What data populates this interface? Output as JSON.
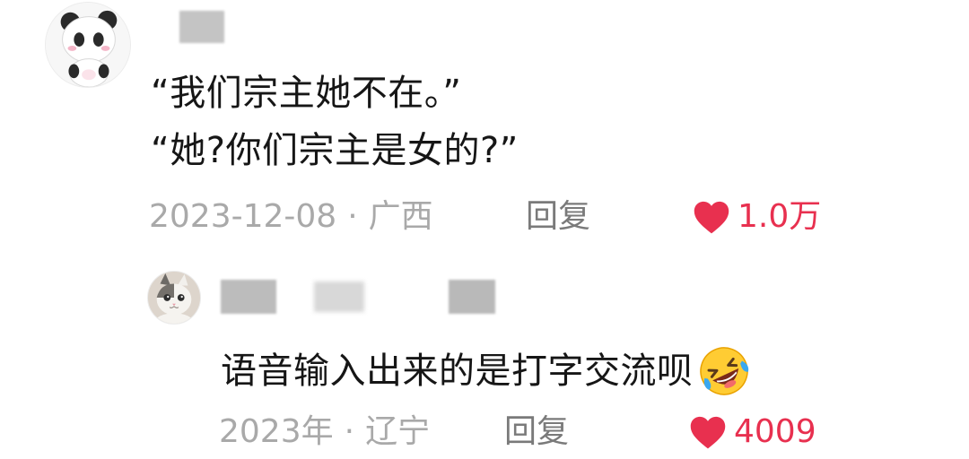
{
  "comment": {
    "lines": [
      "“我们宗主她不在。”",
      "“她?你们宗主是女的?”"
    ],
    "date": "2023-12-08",
    "separator": "·",
    "location": "广西",
    "reply_label": "回复",
    "likes": "1.0万",
    "avatar_icon": "panda-avatar-icon"
  },
  "reply": {
    "text": "语音输入出来的是打字交流呗",
    "emoji": "rolling-laughing-emoji-icon",
    "date": "2023年",
    "separator": "·",
    "location": "辽宁",
    "reply_label": "回复",
    "likes": "4009",
    "avatar_icon": "cat-avatar-icon"
  },
  "colors": {
    "like_red": "#e8304f",
    "meta_gray": "#a9a9a9",
    "reply_gray": "#7a7a7a",
    "text": "#161616"
  }
}
